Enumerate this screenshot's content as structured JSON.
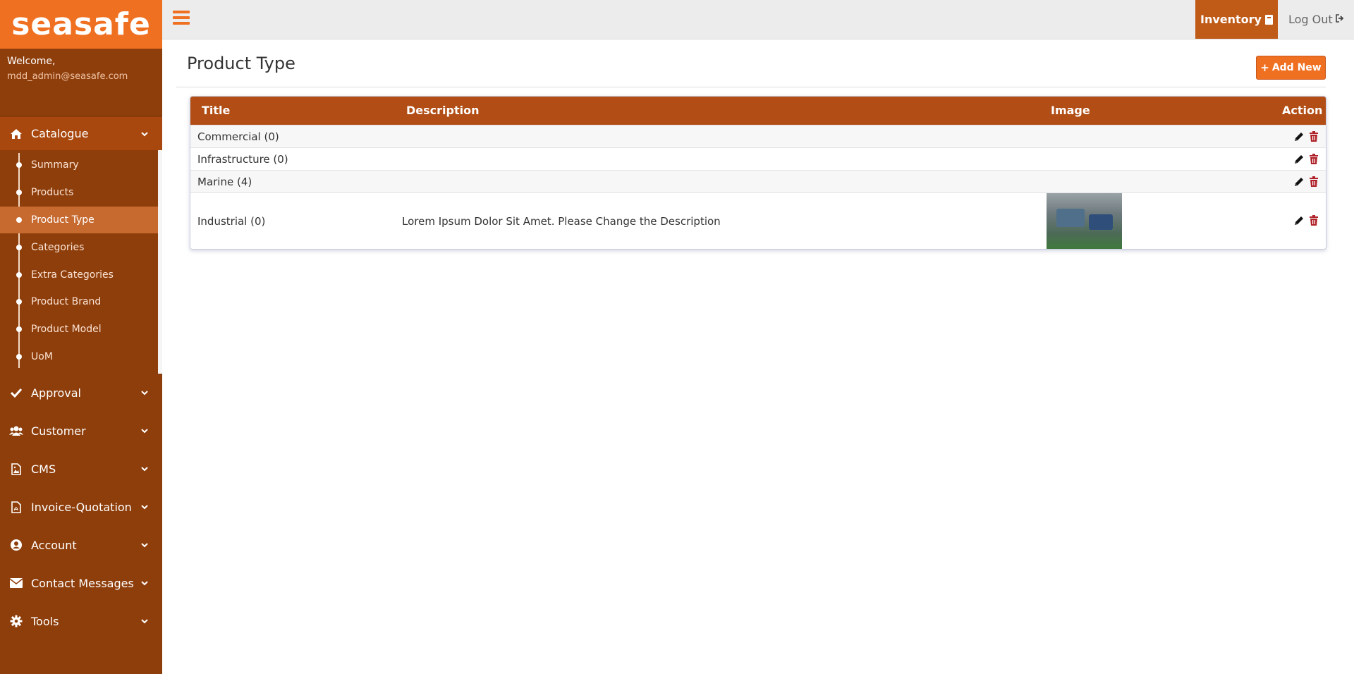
{
  "brand": {
    "logo_text": "seasafe",
    "accent": "#f07022",
    "sidebar_bg": "#8e3e0b"
  },
  "user": {
    "welcome": "Welcome,",
    "email": "mdd_admin@seasafe.com"
  },
  "sidebar": {
    "catalogue": {
      "label": "Catalogue",
      "icon": "home-icon",
      "children": [
        {
          "label": "Summary"
        },
        {
          "label": "Products"
        },
        {
          "label": "Product Type"
        },
        {
          "label": "Categories"
        },
        {
          "label": "Extra Categories"
        },
        {
          "label": "Product Brand"
        },
        {
          "label": "Product Model"
        },
        {
          "label": "UoM"
        }
      ]
    },
    "items": [
      {
        "label": "Approval",
        "icon": "check-icon"
      },
      {
        "label": "Customer",
        "icon": "users-icon"
      },
      {
        "label": "CMS",
        "icon": "image-file-icon"
      },
      {
        "label": "Invoice-Quotation",
        "icon": "pdf-file-icon"
      },
      {
        "label": "Account",
        "icon": "user-circle-icon"
      },
      {
        "label": "Contact Messages",
        "icon": "envelope-icon"
      },
      {
        "label": "Tools",
        "icon": "gear-icon"
      }
    ]
  },
  "topbar": {
    "inventory_label": "Inventory",
    "logout_label": "Log Out"
  },
  "main": {
    "title": "Product Type",
    "add_button": "Add New",
    "table": {
      "headers": {
        "title": "Title",
        "description": "Description",
        "image": "Image",
        "action": "Action"
      },
      "rows": [
        {
          "title": "Commercial (0)",
          "description": ""
        },
        {
          "title": "Infrastructure (0)",
          "description": ""
        },
        {
          "title": "Marine (4)",
          "description": ""
        },
        {
          "title": "Industrial (0)",
          "description": "Lorem Ipsum Dolor Sit Amet. Please Change the Description"
        }
      ]
    }
  }
}
